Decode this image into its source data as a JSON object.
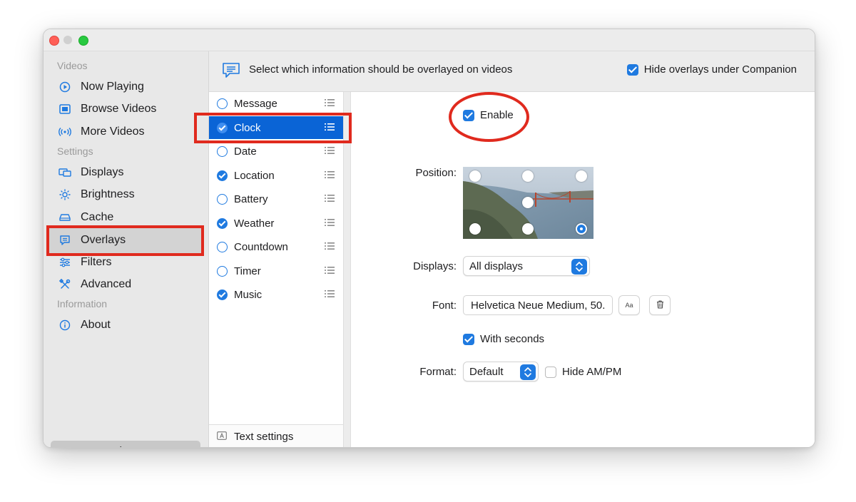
{
  "window": {
    "traffic_lights": [
      "close",
      "minimize",
      "zoom"
    ]
  },
  "sidebar": {
    "sections": [
      {
        "title": "Videos",
        "items": [
          {
            "label": "Now Playing",
            "icon": "play-circle-icon"
          },
          {
            "label": "Browse Videos",
            "icon": "film-icon"
          },
          {
            "label": "More Videos",
            "icon": "antenna-icon"
          }
        ]
      },
      {
        "title": "Settings",
        "items": [
          {
            "label": "Displays",
            "icon": "displays-icon"
          },
          {
            "label": "Brightness",
            "icon": "sun-icon"
          },
          {
            "label": "Cache",
            "icon": "drive-icon"
          },
          {
            "label": "Overlays",
            "icon": "speech-bubble-icon",
            "selected": true
          },
          {
            "label": "Filters",
            "icon": "sliders-icon"
          },
          {
            "label": "Advanced",
            "icon": "tools-icon"
          }
        ]
      },
      {
        "title": "Information",
        "items": [
          {
            "label": "About",
            "icon": "info-icon"
          }
        ]
      }
    ],
    "close_label": "Close"
  },
  "header": {
    "icon": "speech-bubble-icon",
    "text": "Select which information should be overlayed on videos",
    "hide_companion_label": "Hide overlays under Companion",
    "hide_companion_checked": true
  },
  "overlay_list": {
    "items": [
      {
        "label": "Message",
        "checked": false
      },
      {
        "label": "Clock",
        "checked": true,
        "selected": true
      },
      {
        "label": "Date",
        "checked": false
      },
      {
        "label": "Location",
        "checked": true
      },
      {
        "label": "Battery",
        "checked": false
      },
      {
        "label": "Weather",
        "checked": true
      },
      {
        "label": "Countdown",
        "checked": false
      },
      {
        "label": "Timer",
        "checked": false
      },
      {
        "label": "Music",
        "checked": true
      }
    ],
    "text_settings_label": "Text settings"
  },
  "detail": {
    "enable_label": "Enable",
    "enable_checked": true,
    "position_label": "Position:",
    "position_selected": "bottom-right",
    "displays_label": "Displays:",
    "displays_value": "All displays",
    "font_label": "Font:",
    "font_value": "Helvetica Neue Medium, 50.",
    "font_button_label": "Aa",
    "with_seconds_label": "With seconds",
    "with_seconds_checked": true,
    "format_label": "Format:",
    "format_value": "Default",
    "hide_ampm_label": "Hide AM/PM",
    "hide_ampm_checked": false
  },
  "colors": {
    "accent": "#1f7ae0",
    "selection": "#0a64d6",
    "highlight_annotation": "#e02a1e"
  }
}
